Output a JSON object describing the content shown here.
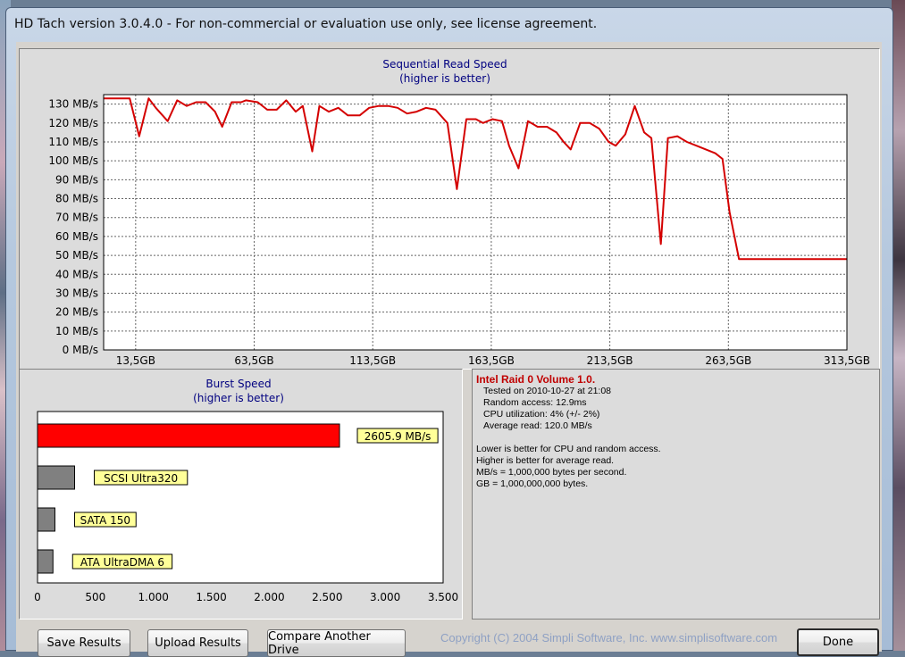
{
  "window": {
    "title": "HD Tach version 3.0.4.0  - For non-commercial or evaluation use only, see license agreement."
  },
  "sequential": {
    "title": "Sequential Read Speed",
    "subtitle": "(higher is better)",
    "line_color": "#d40000"
  },
  "burst": {
    "title": "Burst Speed",
    "subtitle": "(higher is better)"
  },
  "chart_data": [
    {
      "type": "line",
      "title": "Sequential Read Speed",
      "subtitle": "(higher is better)",
      "ylabel": "",
      "xlabel": "",
      "ylim": [
        0,
        135
      ],
      "xlim": [
        0,
        313.5
      ],
      "yticks": [
        "0 MB/s",
        "10 MB/s",
        "20 MB/s",
        "30 MB/s",
        "40 MB/s",
        "50 MB/s",
        "60 MB/s",
        "70 MB/s",
        "80 MB/s",
        "90 MB/s",
        "100 MB/s",
        "110 MB/s",
        "120 MB/s",
        "130 MB/s"
      ],
      "ytick_values": [
        0,
        10,
        20,
        30,
        40,
        50,
        60,
        70,
        80,
        90,
        100,
        110,
        120,
        130
      ],
      "xticks": [
        "13,5GB",
        "63,5GB",
        "113,5GB",
        "163,5GB",
        "213,5GB",
        "263,5GB",
        "313,5GB"
      ],
      "xtick_values": [
        13.5,
        63.5,
        113.5,
        163.5,
        213.5,
        263.5,
        313.5
      ],
      "grid": true,
      "series": [
        {
          "color": "#d40000",
          "x": [
            0,
            4,
            8,
            11,
            15,
            19,
            22,
            27,
            31,
            35,
            39,
            43,
            47,
            50,
            54,
            58,
            60,
            65,
            69,
            73,
            77,
            81,
            84,
            88,
            91,
            95,
            99,
            103,
            108,
            112,
            116,
            120,
            124,
            128,
            132,
            136,
            140,
            145,
            149,
            153,
            157,
            160,
            164,
            168,
            171,
            175,
            179,
            183,
            187,
            191,
            194,
            197,
            201,
            205,
            209,
            213,
            216,
            220,
            224,
            228,
            231,
            235,
            238,
            242,
            246,
            250,
            254,
            258,
            261,
            264,
            268,
            272,
            276,
            282,
            286,
            290,
            294,
            298,
            301,
            305,
            310,
            313.5
          ],
          "y": [
            133,
            133,
            133,
            133,
            113,
            133,
            128,
            121,
            132,
            129,
            131,
            131,
            126,
            118,
            131,
            131,
            132,
            131,
            127,
            127,
            132,
            126,
            129,
            105,
            129,
            126,
            128,
            124,
            124,
            128,
            129,
            129,
            128,
            125,
            126,
            128,
            127,
            120,
            85,
            122,
            122,
            120,
            122,
            121,
            108,
            96,
            121,
            118,
            118,
            115,
            110,
            106,
            120,
            120,
            117,
            110,
            108,
            114,
            129,
            115,
            112,
            56,
            112,
            113,
            110,
            108,
            106,
            104,
            101,
            73,
            48,
            48,
            48,
            48,
            48,
            48,
            48,
            48,
            48,
            48,
            48,
            48
          ]
        }
      ]
    },
    {
      "type": "bar",
      "orientation": "horizontal",
      "title": "Burst Speed",
      "subtitle": "(higher is better)",
      "xlim": [
        0,
        3500
      ],
      "xticks": [
        "0",
        "500",
        "1.000",
        "1.500",
        "2.000",
        "2.500",
        "3.000",
        "3.500"
      ],
      "xtick_values": [
        0,
        500,
        1000,
        1500,
        2000,
        2500,
        3000,
        3500
      ],
      "categories": [
        "2605.9 MB/s",
        "SCSI Ultra320",
        "SATA 150",
        "ATA UltraDMA 6"
      ],
      "values": [
        2605.9,
        320,
        150,
        133
      ],
      "colors": [
        "#ff0000",
        "#808080",
        "#808080",
        "#808080"
      ]
    }
  ],
  "info": {
    "title": "Intel Raid 0 Volume 1.0.",
    "tested": "Tested on 2010-10-27 at 21:08",
    "random_access": "Random access: 12.9ms",
    "cpu": "CPU utilization: 4% (+/- 2%)",
    "avg_read": "Average read: 120.0 MB/s",
    "note1": "Lower is better for CPU and random access.",
    "note2": "Higher is better for average read.",
    "note3": "MB/s = 1,000,000 bytes per second.",
    "note4": "GB = 1,000,000,000 bytes."
  },
  "buttons": {
    "save": "Save Results",
    "upload": "Upload Results",
    "compare": "Compare Another Drive",
    "done": "Done"
  },
  "copyright": "Copyright (C) 2004 Simpli Software, Inc. www.simplisoftware.com"
}
